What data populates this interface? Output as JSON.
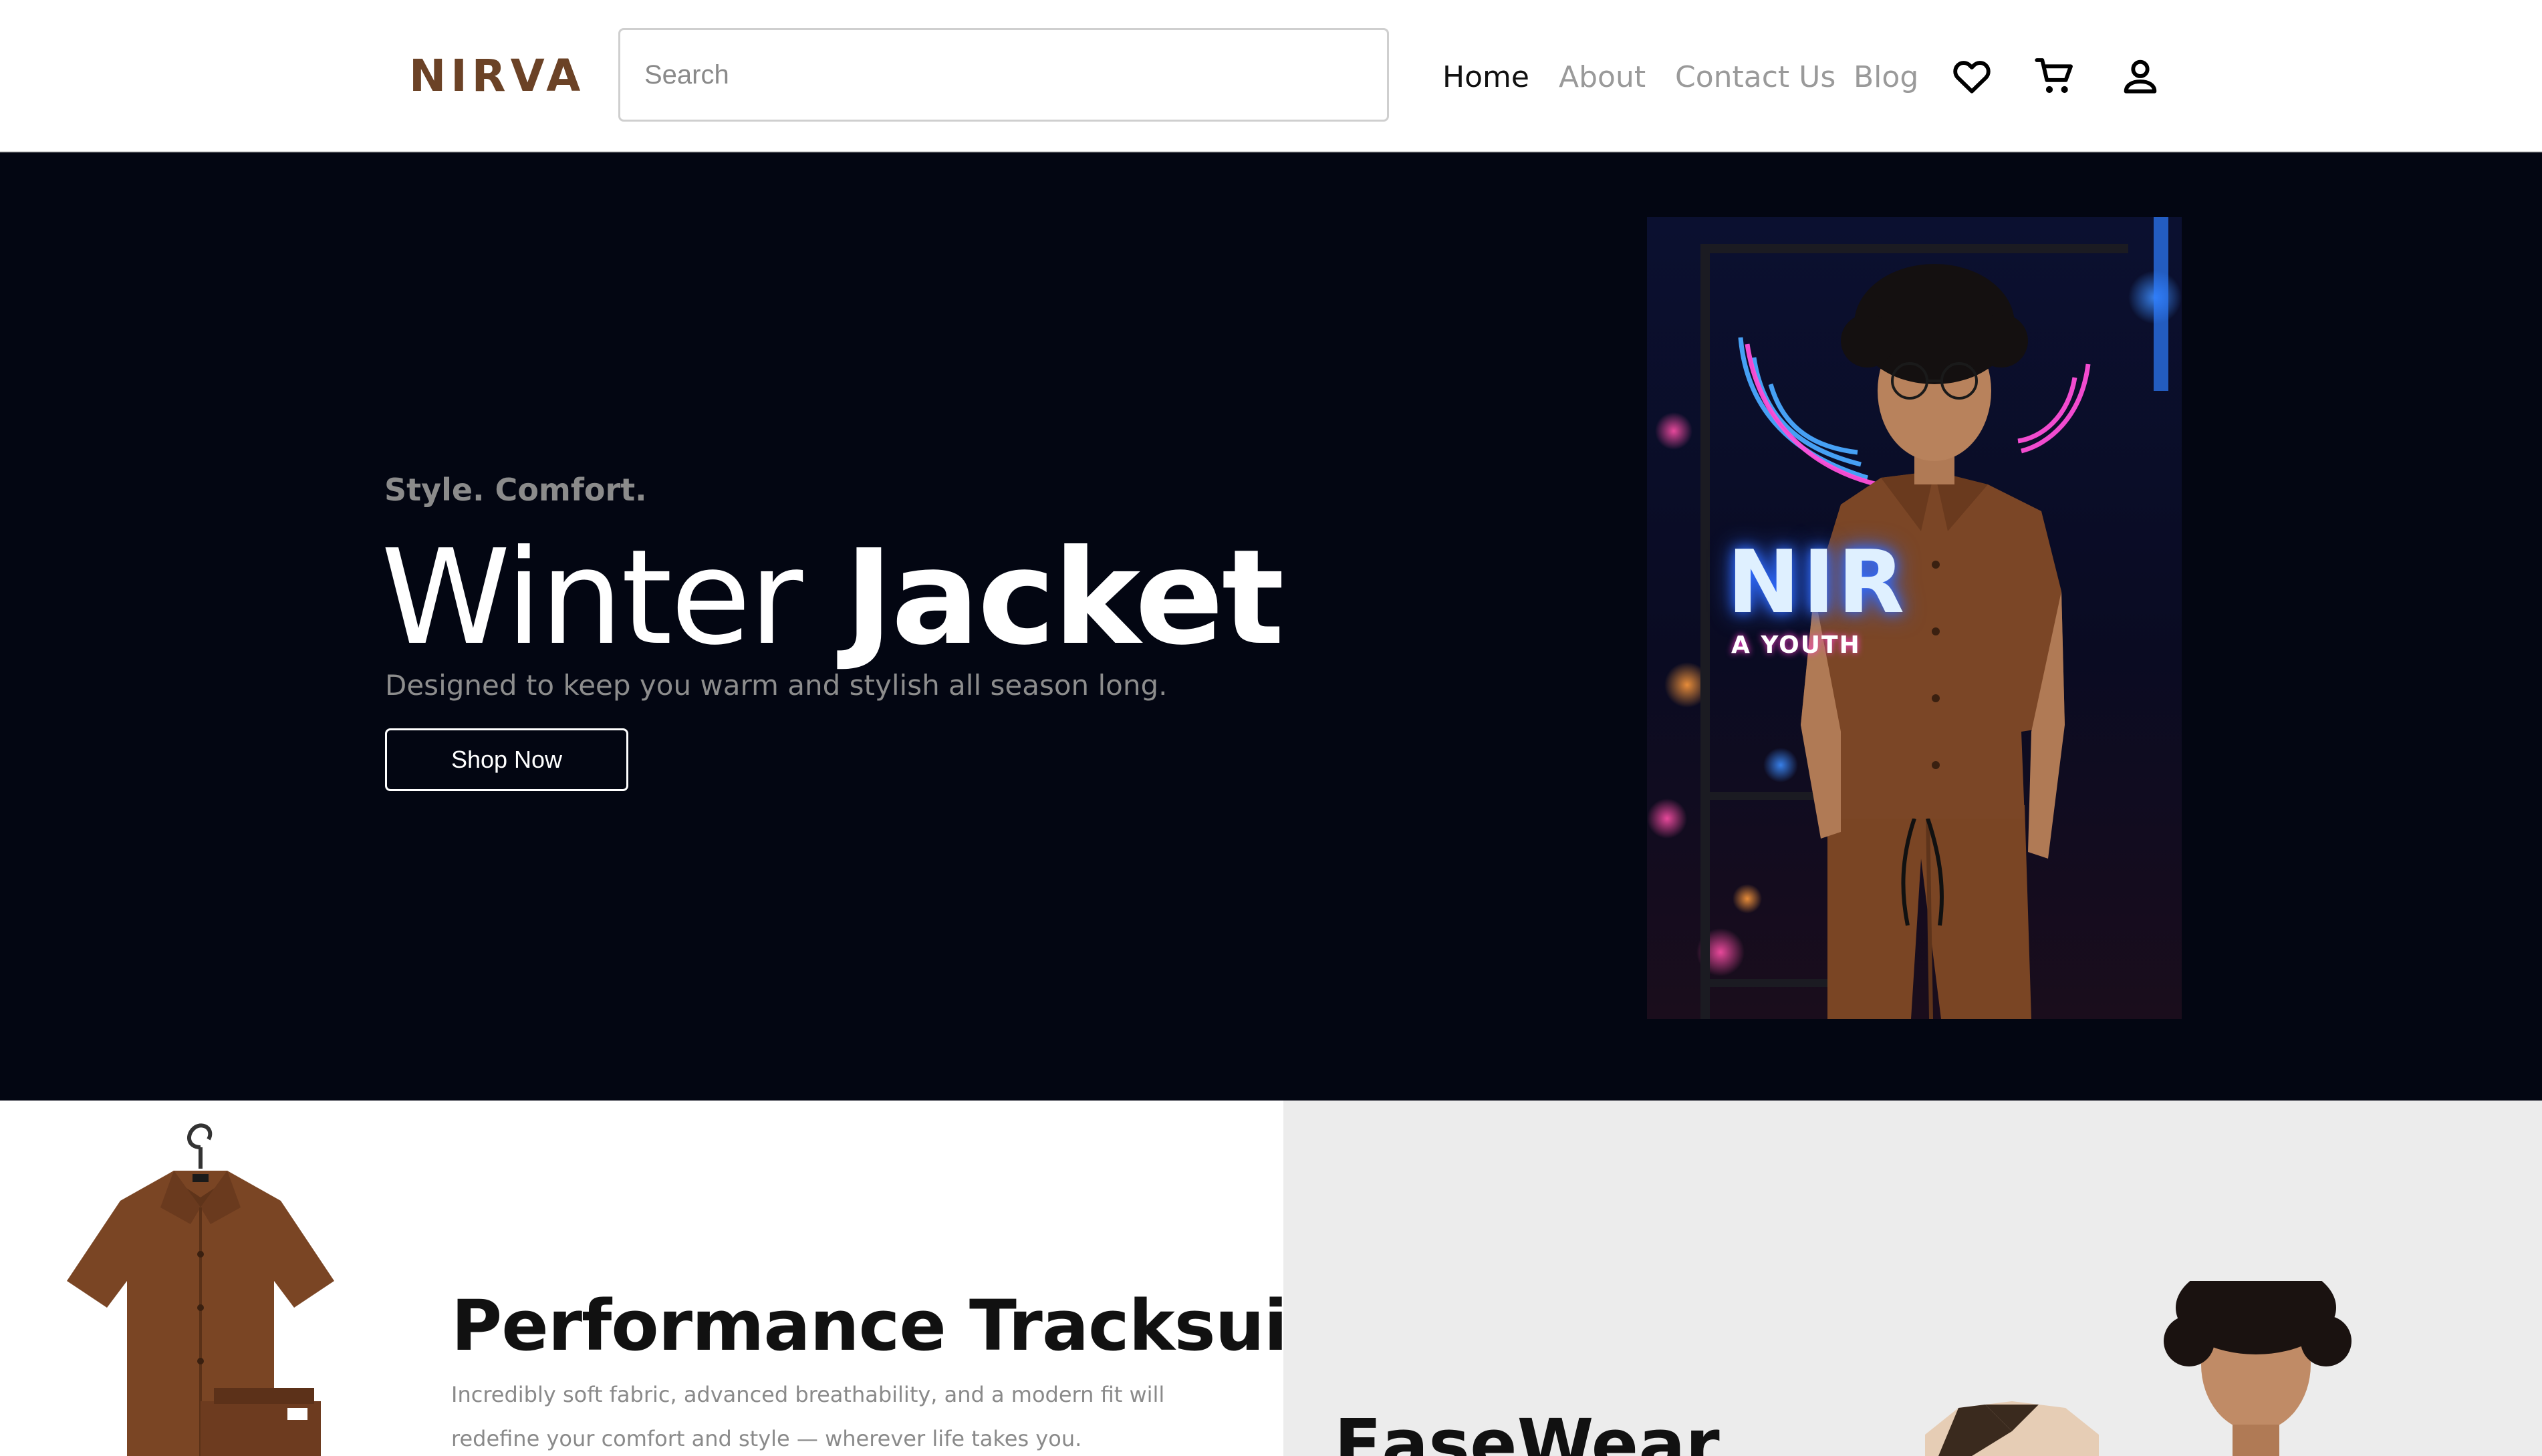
{
  "header": {
    "logo": "NIRVA",
    "search": {
      "placeholder": "Search",
      "value": ""
    },
    "nav": [
      {
        "label": "Home",
        "active": true
      },
      {
        "label": "About",
        "active": false
      },
      {
        "label": "Contact Us",
        "active": false
      },
      {
        "label": "Blog",
        "active": false
      }
    ],
    "icons": [
      "heart-icon",
      "cart-icon",
      "user-icon"
    ]
  },
  "hero": {
    "tagline": "Style. Comfort.",
    "headline_light": "Winter",
    "headline_bold": "Jacket",
    "subtitle": "Designed to keep you warm and stylish all season long.",
    "cta_label": "Shop Now",
    "neon_sign_text": "NIR",
    "neon_sign_sub": "A YOUTH"
  },
  "products": [
    {
      "title": "Performance Tracksuit",
      "description": "Incredibly soft fabric, advanced breathability, and a modern fit will redefine your comfort and style — wherever life takes you."
    },
    {
      "title": "EaseWear"
    }
  ],
  "colors": {
    "brand": "#6b4226",
    "hero_bg": "#030612",
    "muted_text": "#8d8d8d",
    "product_alt_bg": "#ececec"
  }
}
